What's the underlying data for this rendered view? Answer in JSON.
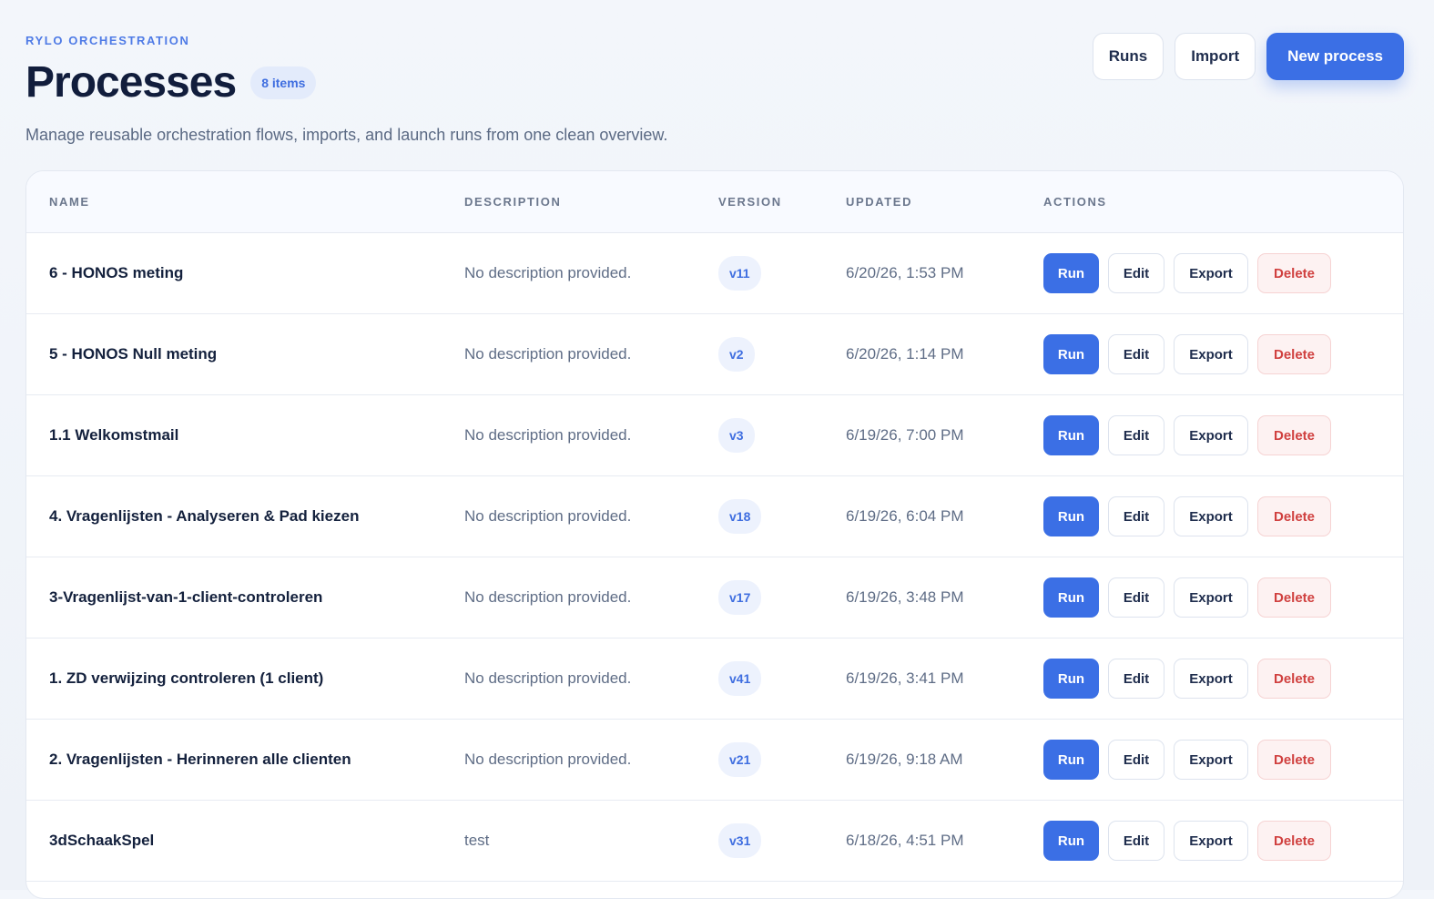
{
  "header": {
    "eyebrow": "RYLO ORCHESTRATION",
    "title": "Processes",
    "count_badge": "8 items",
    "subtitle": "Manage reusable orchestration flows, imports, and launch runs from one clean overview.",
    "actions": {
      "runs_label": "Runs",
      "import_label": "Import",
      "new_process_label": "New process"
    }
  },
  "table": {
    "columns": {
      "name": "NAME",
      "description": "DESCRIPTION",
      "version": "VERSION",
      "updated": "UPDATED",
      "actions": "ACTIONS"
    },
    "action_labels": {
      "run": "Run",
      "edit": "Edit",
      "export": "Export",
      "delete": "Delete"
    },
    "rows": [
      {
        "name": "6 - HONOS meting",
        "description": "No description provided.",
        "version": "v11",
        "updated": "6/20/26, 1:53 PM"
      },
      {
        "name": "5 - HONOS Null meting",
        "description": "No description provided.",
        "version": "v2",
        "updated": "6/20/26, 1:14 PM"
      },
      {
        "name": "1.1 Welkomstmail",
        "description": "No description provided.",
        "version": "v3",
        "updated": "6/19/26, 7:00 PM"
      },
      {
        "name": "4. Vragenlijsten - Analyseren & Pad kiezen",
        "description": "No description provided.",
        "version": "v18",
        "updated": "6/19/26, 6:04 PM"
      },
      {
        "name": "3-Vragenlijst-van-1-client-controleren",
        "description": "No description provided.",
        "version": "v17",
        "updated": "6/19/26, 3:48 PM"
      },
      {
        "name": "1. ZD verwijzing controleren (1 client)",
        "description": "No description provided.",
        "version": "v41",
        "updated": "6/19/26, 3:41 PM"
      },
      {
        "name": "2. Vragenlijsten - Herinneren alle clienten",
        "description": "No description provided.",
        "version": "v21",
        "updated": "6/19/26, 9:18 AM"
      },
      {
        "name": "3dSchaakSpel",
        "description": "test",
        "version": "v31",
        "updated": "6/18/26, 4:51 PM"
      }
    ]
  },
  "colors": {
    "accent": "#3b6fe5",
    "danger": "#d0403f",
    "heading": "#111d3c"
  }
}
